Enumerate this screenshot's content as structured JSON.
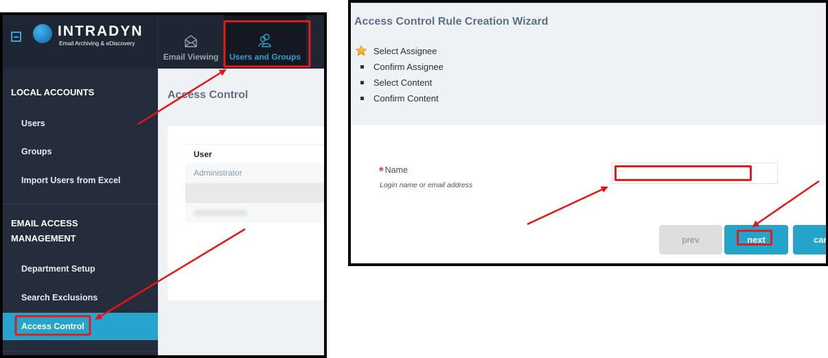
{
  "left_screenshot": {
    "brand": {
      "name": "INTRADYN",
      "tagline": "Email Archiving & eDiscovery"
    },
    "nav_tabs": [
      {
        "label": "Email Viewing",
        "icon": "envelope-open-icon",
        "active": false
      },
      {
        "label": "Users and Groups",
        "icon": "users-icon",
        "active": true
      }
    ],
    "sidebar": {
      "sections": [
        {
          "header": "LOCAL ACCOUNTS",
          "items": [
            {
              "label": "Users"
            },
            {
              "label": "Groups"
            },
            {
              "label": "Import Users from Excel"
            }
          ]
        },
        {
          "header_line1": "EMAIL ACCESS",
          "header_line2": "MANAGEMENT",
          "items": [
            {
              "label": "Department Setup"
            },
            {
              "label": "Search Exclusions"
            },
            {
              "label": "Access Control",
              "active": true
            }
          ]
        }
      ]
    },
    "main": {
      "title": "Access Control",
      "table": {
        "header": "User",
        "rows": [
          "Administrator",
          "",
          "(blurred)"
        ]
      }
    }
  },
  "right_screenshot": {
    "wizard": {
      "title": "Access Control Rule Creation Wizard",
      "steps": [
        {
          "label": "Select Assignee",
          "current": true
        },
        {
          "label": "Confirm Assignee",
          "current": false
        },
        {
          "label": "Select Content",
          "current": false
        },
        {
          "label": "Confirm Content",
          "current": false
        }
      ]
    },
    "form": {
      "name_label": "Name",
      "required_marker": "*",
      "name_hint": "Login name or email address",
      "name_value": ""
    },
    "buttons": {
      "prev": "prev",
      "next": "next",
      "cancel": "cancel"
    }
  },
  "colors": {
    "accent": "#25a5cd",
    "topbar": "#1e2533",
    "sidebar": "#252c3b",
    "annotation_red": "#e31c1c",
    "title_slate": "#5c6f87"
  }
}
